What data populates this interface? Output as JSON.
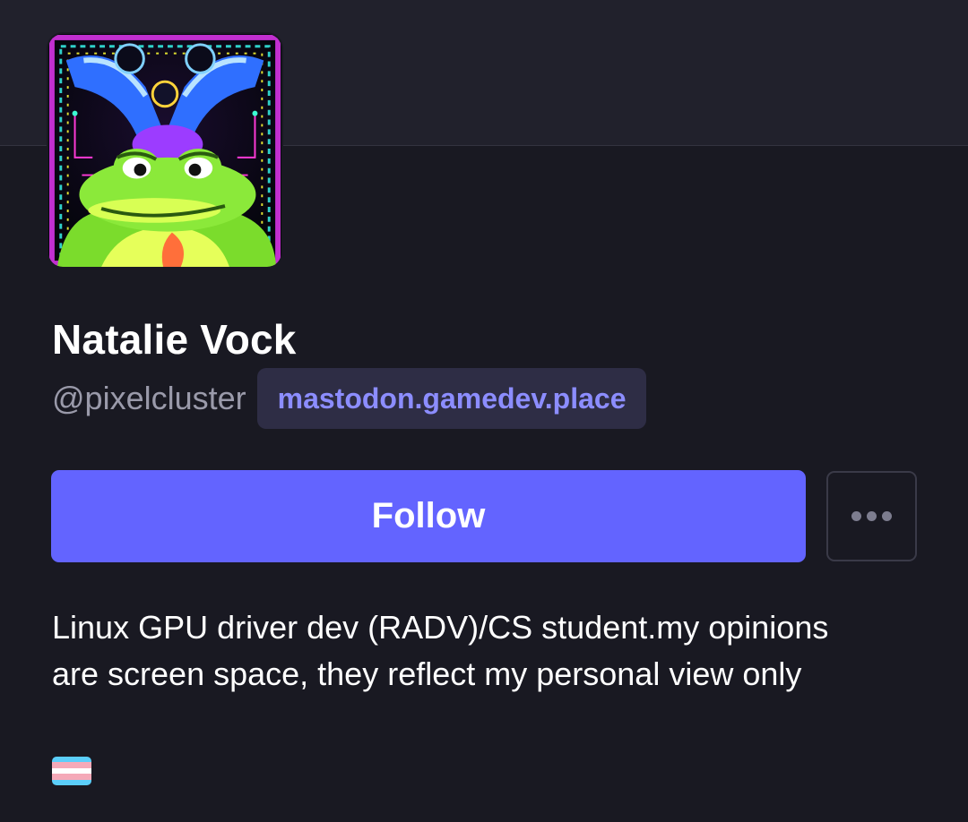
{
  "profile": {
    "display_name": "Natalie Vock",
    "handle": "@pixelcluster",
    "domain": "mastodon.gamedev.place",
    "bio_line1": "Linux GPU driver dev (RADV)/CS student.my opinions",
    "bio_line2": "are screen space, they reflect my personal view only"
  },
  "actions": {
    "follow_label": "Follow",
    "more_icon": "ellipsis-icon"
  },
  "flag": {
    "icon": "transgender-flag-icon",
    "colors": [
      "#5bcefa",
      "#f5a9b8",
      "#ffffff",
      "#f5a9b8",
      "#5bcefa"
    ]
  },
  "colors": {
    "accent": "#6364ff",
    "background": "#191922",
    "header": "#21212c",
    "badge_bg": "#2e2d45",
    "badge_text": "#8c8dff"
  }
}
